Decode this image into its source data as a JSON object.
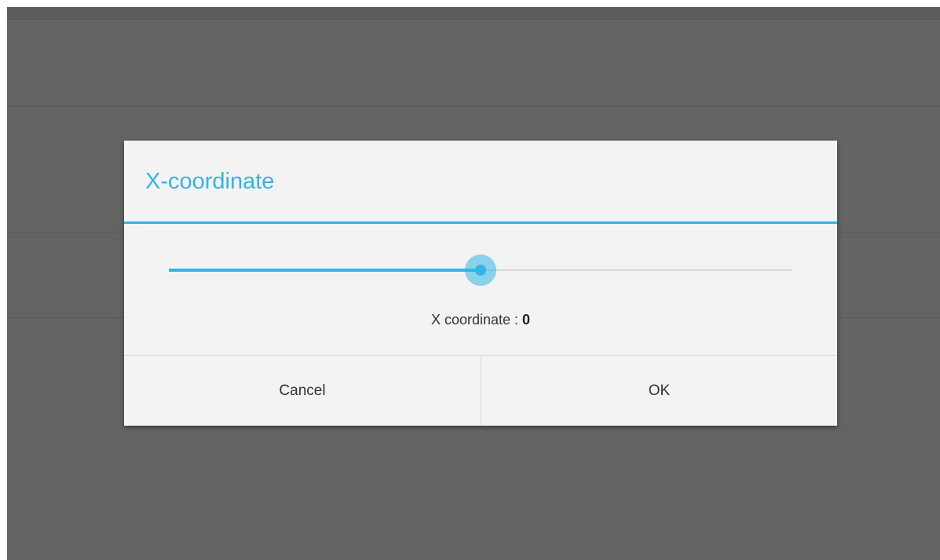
{
  "dialog": {
    "title": "X-coordinate",
    "value_label": "X coordinate : ",
    "value": "0",
    "slider": {
      "fraction": 0.5,
      "accent_color": "#33b5e5"
    },
    "buttons": {
      "cancel": "Cancel",
      "ok": "OK"
    }
  },
  "colors": {
    "accent": "#33b5e5",
    "scrim": "#646464",
    "dialog_bg": "#f3f3f3"
  }
}
